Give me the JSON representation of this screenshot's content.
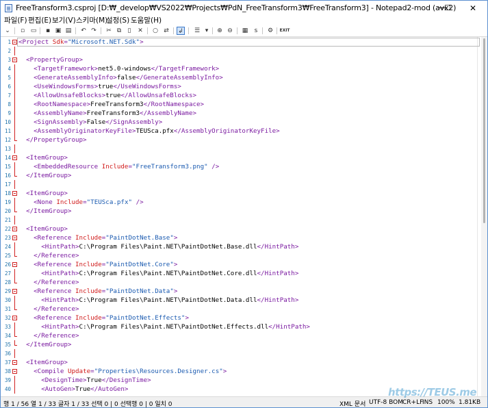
{
  "window": {
    "title": "FreeTransform3.csproj [D:₩_develop₩VS2022₩Projects₩PdN_FreeTransform3₩FreeTransform3] - Notepad2-mod (avx2)",
    "min_icon": "—",
    "max_icon": "☐",
    "close_icon": "✕"
  },
  "menu": [
    "파일(F)",
    "편집(E)",
    "보기(V)",
    "스키마(M)",
    "설정(S)",
    "도움말(H)"
  ],
  "toolbar": {
    "exit_label": "EXIT"
  },
  "editor": {
    "lines": [
      {
        "n": "1",
        "fold": "open",
        "parts": [
          [
            "k",
            "<Project "
          ],
          [
            "a",
            "Sdk"
          ],
          [
            "k",
            "="
          ],
          [
            "s",
            "\"Microsoft.NET.Sdk\""
          ],
          [
            "k",
            ">"
          ]
        ]
      },
      {
        "n": "2",
        "parts": []
      },
      {
        "n": "3",
        "fold": "open",
        "parts": [
          [
            "t",
            "  "
          ],
          [
            "k",
            "<PropertyGroup>"
          ]
        ]
      },
      {
        "n": "4",
        "parts": [
          [
            "t",
            "    "
          ],
          [
            "k",
            "<TargetFramework>"
          ],
          [
            "t",
            "net5.0-windows"
          ],
          [
            "k",
            "</TargetFramework>"
          ]
        ]
      },
      {
        "n": "5",
        "parts": [
          [
            "t",
            "    "
          ],
          [
            "k",
            "<GenerateAssemblyInfo>"
          ],
          [
            "t",
            "false"
          ],
          [
            "k",
            "</GenerateAssemblyInfo>"
          ]
        ]
      },
      {
        "n": "6",
        "parts": [
          [
            "t",
            "    "
          ],
          [
            "k",
            "<UseWindowsForms>"
          ],
          [
            "t",
            "true"
          ],
          [
            "k",
            "</UseWindowsForms>"
          ]
        ]
      },
      {
        "n": "7",
        "parts": [
          [
            "t",
            "    "
          ],
          [
            "k",
            "<AllowUnsafeBlocks>"
          ],
          [
            "t",
            "true"
          ],
          [
            "k",
            "</AllowUnsafeBlocks>"
          ]
        ]
      },
      {
        "n": "8",
        "parts": [
          [
            "t",
            "    "
          ],
          [
            "k",
            "<RootNamespace>"
          ],
          [
            "t",
            "FreeTransform3"
          ],
          [
            "k",
            "</RootNamespace>"
          ]
        ]
      },
      {
        "n": "9",
        "parts": [
          [
            "t",
            "    "
          ],
          [
            "k",
            "<AssemblyName>"
          ],
          [
            "t",
            "FreeTransform3"
          ],
          [
            "k",
            "</AssemblyName>"
          ]
        ]
      },
      {
        "n": "10",
        "parts": [
          [
            "t",
            "    "
          ],
          [
            "k",
            "<SignAssembly>"
          ],
          [
            "t",
            "False"
          ],
          [
            "k",
            "</SignAssembly>"
          ]
        ]
      },
      {
        "n": "11",
        "parts": [
          [
            "t",
            "    "
          ],
          [
            "k",
            "<AssemblyOriginatorKeyFile>"
          ],
          [
            "t",
            "TEUSca.pfx"
          ],
          [
            "k",
            "</AssemblyOriginatorKeyFile>"
          ]
        ]
      },
      {
        "n": "12",
        "foldend": true,
        "parts": [
          [
            "t",
            "  "
          ],
          [
            "k",
            "</PropertyGroup>"
          ]
        ]
      },
      {
        "n": "13",
        "parts": []
      },
      {
        "n": "14",
        "fold": "open",
        "parts": [
          [
            "t",
            "  "
          ],
          [
            "k",
            "<ItemGroup>"
          ]
        ]
      },
      {
        "n": "15",
        "parts": [
          [
            "t",
            "    "
          ],
          [
            "k",
            "<EmbeddedResource "
          ],
          [
            "a",
            "Include"
          ],
          [
            "k",
            "="
          ],
          [
            "s",
            "\"FreeTransform3.png\""
          ],
          [
            "t",
            " "
          ],
          [
            "k",
            "/>"
          ]
        ]
      },
      {
        "n": "16",
        "foldend": true,
        "parts": [
          [
            "t",
            "  "
          ],
          [
            "k",
            "</ItemGroup>"
          ]
        ]
      },
      {
        "n": "17",
        "parts": []
      },
      {
        "n": "18",
        "fold": "open",
        "parts": [
          [
            "t",
            "  "
          ],
          [
            "k",
            "<ItemGroup>"
          ]
        ]
      },
      {
        "n": "19",
        "parts": [
          [
            "t",
            "    "
          ],
          [
            "k",
            "<None "
          ],
          [
            "a",
            "Include"
          ],
          [
            "k",
            "="
          ],
          [
            "s",
            "\"TEUSca.pfx\""
          ],
          [
            "t",
            " "
          ],
          [
            "k",
            "/>"
          ]
        ]
      },
      {
        "n": "20",
        "foldend": true,
        "parts": [
          [
            "t",
            "  "
          ],
          [
            "k",
            "</ItemGroup>"
          ]
        ]
      },
      {
        "n": "21",
        "parts": []
      },
      {
        "n": "22",
        "fold": "open",
        "parts": [
          [
            "t",
            "  "
          ],
          [
            "k",
            "<ItemGroup>"
          ]
        ]
      },
      {
        "n": "23",
        "fold": "open",
        "parts": [
          [
            "t",
            "    "
          ],
          [
            "k",
            "<Reference "
          ],
          [
            "a",
            "Include"
          ],
          [
            "k",
            "="
          ],
          [
            "s",
            "\"PaintDotNet.Base\""
          ],
          [
            "k",
            ">"
          ]
        ]
      },
      {
        "n": "24",
        "parts": [
          [
            "t",
            "      "
          ],
          [
            "k",
            "<HintPath>"
          ],
          [
            "t",
            "C:\\Program Files\\Paint.NET\\PaintDotNet.Base.dll"
          ],
          [
            "k",
            "</HintPath>"
          ]
        ]
      },
      {
        "n": "25",
        "foldend": true,
        "parts": [
          [
            "t",
            "    "
          ],
          [
            "k",
            "</Reference>"
          ]
        ]
      },
      {
        "n": "26",
        "fold": "open",
        "parts": [
          [
            "t",
            "    "
          ],
          [
            "k",
            "<Reference "
          ],
          [
            "a",
            "Include"
          ],
          [
            "k",
            "="
          ],
          [
            "s",
            "\"PaintDotNet.Core\""
          ],
          [
            "k",
            ">"
          ]
        ]
      },
      {
        "n": "27",
        "parts": [
          [
            "t",
            "      "
          ],
          [
            "k",
            "<HintPath>"
          ],
          [
            "t",
            "C:\\Program Files\\Paint.NET\\PaintDotNet.Core.dll"
          ],
          [
            "k",
            "</HintPath>"
          ]
        ]
      },
      {
        "n": "28",
        "foldend": true,
        "parts": [
          [
            "t",
            "    "
          ],
          [
            "k",
            "</Reference>"
          ]
        ]
      },
      {
        "n": "29",
        "fold": "open",
        "parts": [
          [
            "t",
            "    "
          ],
          [
            "k",
            "<Reference "
          ],
          [
            "a",
            "Include"
          ],
          [
            "k",
            "="
          ],
          [
            "s",
            "\"PaintDotNet.Data\""
          ],
          [
            "k",
            ">"
          ]
        ]
      },
      {
        "n": "30",
        "parts": [
          [
            "t",
            "      "
          ],
          [
            "k",
            "<HintPath>"
          ],
          [
            "t",
            "C:\\Program Files\\Paint.NET\\PaintDotNet.Data.dll"
          ],
          [
            "k",
            "</HintPath>"
          ]
        ]
      },
      {
        "n": "31",
        "foldend": true,
        "parts": [
          [
            "t",
            "    "
          ],
          [
            "k",
            "</Reference>"
          ]
        ]
      },
      {
        "n": "32",
        "fold": "open",
        "parts": [
          [
            "t",
            "    "
          ],
          [
            "k",
            "<Reference "
          ],
          [
            "a",
            "Include"
          ],
          [
            "k",
            "="
          ],
          [
            "s",
            "\"PaintDotNet.Effects\""
          ],
          [
            "k",
            ">"
          ]
        ]
      },
      {
        "n": "33",
        "parts": [
          [
            "t",
            "      "
          ],
          [
            "k",
            "<HintPath>"
          ],
          [
            "t",
            "C:\\Program Files\\Paint.NET\\PaintDotNet.Effects.dll"
          ],
          [
            "k",
            "</HintPath>"
          ]
        ]
      },
      {
        "n": "34",
        "foldend": true,
        "parts": [
          [
            "t",
            "    "
          ],
          [
            "k",
            "</Reference>"
          ]
        ]
      },
      {
        "n": "35",
        "foldend": true,
        "parts": [
          [
            "t",
            "  "
          ],
          [
            "k",
            "</ItemGroup>"
          ]
        ]
      },
      {
        "n": "36",
        "parts": []
      },
      {
        "n": "37",
        "fold": "open",
        "parts": [
          [
            "t",
            "  "
          ],
          [
            "k",
            "<ItemGroup>"
          ]
        ]
      },
      {
        "n": "38",
        "fold": "open",
        "parts": [
          [
            "t",
            "    "
          ],
          [
            "k",
            "<Compile "
          ],
          [
            "a",
            "Update"
          ],
          [
            "k",
            "="
          ],
          [
            "s",
            "\"Properties\\Resources.Designer.cs\""
          ],
          [
            "k",
            ">"
          ]
        ]
      },
      {
        "n": "39",
        "parts": [
          [
            "t",
            "      "
          ],
          [
            "k",
            "<DesignTime>"
          ],
          [
            "t",
            "True"
          ],
          [
            "k",
            "</DesignTime>"
          ]
        ]
      },
      {
        "n": "40",
        "parts": [
          [
            "t",
            "      "
          ],
          [
            "k",
            "<AutoGen>"
          ],
          [
            "t",
            "True"
          ],
          [
            "k",
            "</AutoGen>"
          ]
        ]
      }
    ]
  },
  "status": {
    "position": "행 1 / 56  열 1 / 33  글자 1 / 33  선택 0 | 0  선택행 0 | 0  일치 0",
    "schema": "XML 문서",
    "encoding": "UTF-8 BOM",
    "eol": "CR+LF",
    "mode": "INS",
    "zoom": "100%",
    "size": "1.81KB"
  },
  "watermark": "https://TEUS.me"
}
